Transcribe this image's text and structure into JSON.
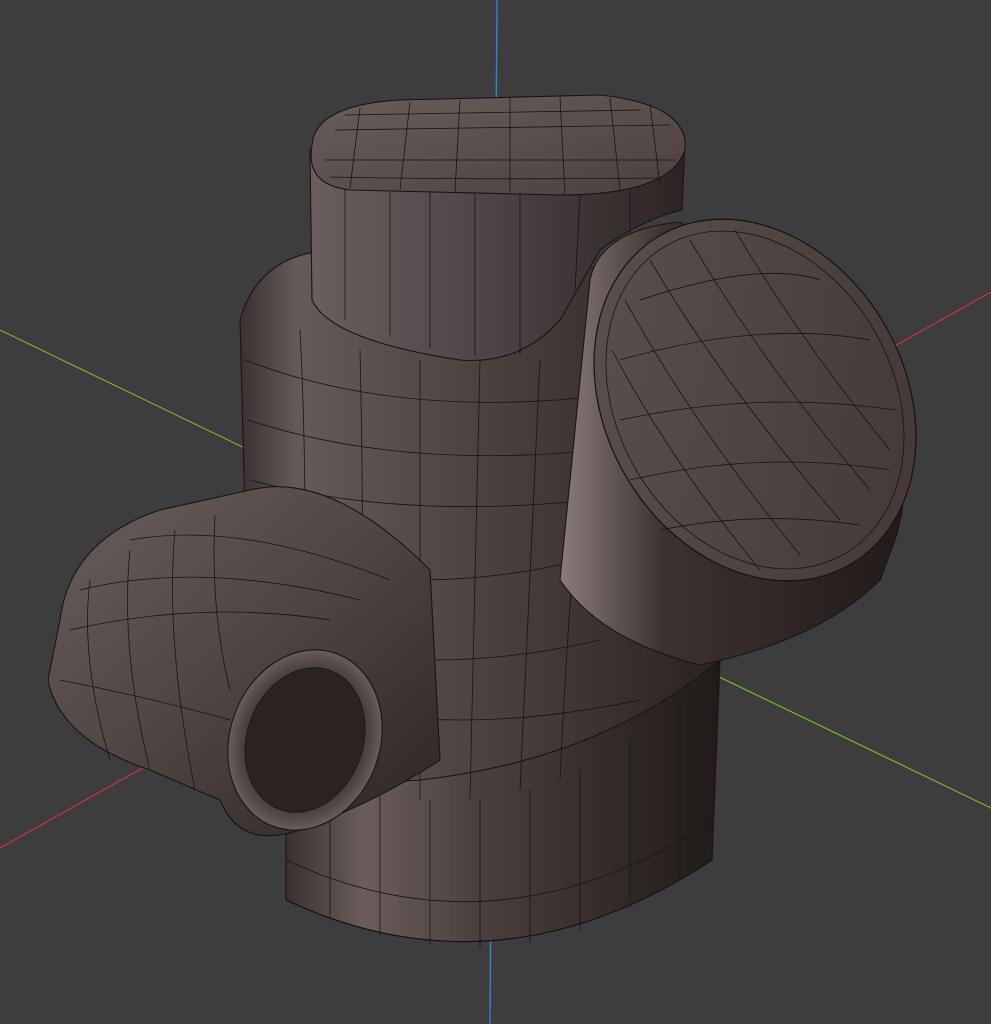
{
  "viewport": {
    "background": "#3d3d3d",
    "mesh_color": "#524644",
    "wire_color": "#1a1414",
    "axis_colors": {
      "x": "#c9343f",
      "y": "#7fb025",
      "z": "#3a7fd4"
    }
  }
}
